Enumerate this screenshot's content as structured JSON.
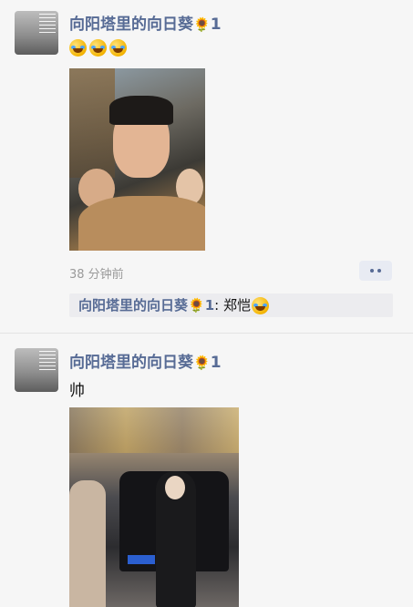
{
  "posts": [
    {
      "username": "向阳塔里的向日葵",
      "username_suffix": "1",
      "content_emoji_count": 3,
      "time": "38 分钟前",
      "comment": {
        "author": "向阳塔里的向日葵",
        "author_suffix": "1",
        "separator": ": ",
        "text": "郑恺"
      }
    },
    {
      "username": "向阳塔里的向日葵",
      "username_suffix": "1",
      "content": "帅"
    }
  ],
  "icons": {
    "sunflower": "sunflower-icon",
    "laugh": "laughing-crying-emoji",
    "more": "more-dots-icon"
  },
  "colors": {
    "username": "#576b95",
    "background": "#f6f6f6",
    "comment_bg": "#ececef"
  }
}
